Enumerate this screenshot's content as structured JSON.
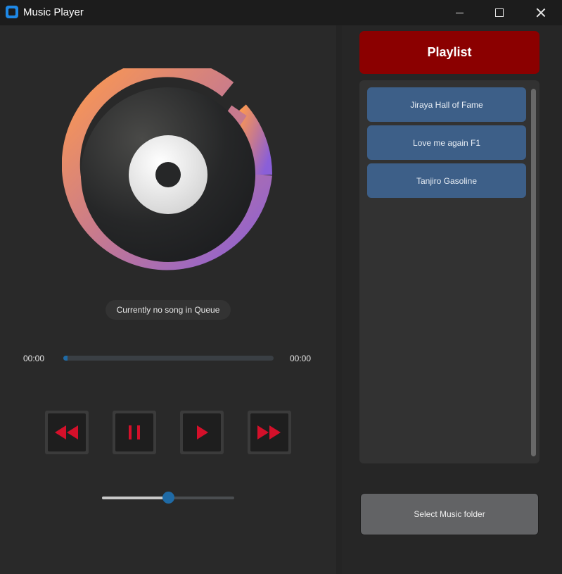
{
  "window": {
    "title": "Music Player",
    "controls": [
      "minimize-icon",
      "maximize-icon",
      "close-icon"
    ]
  },
  "player": {
    "status_text": "Currently no song in Queue",
    "time_elapsed": "00:00",
    "time_total": "00:00",
    "progress": 0.02,
    "volume": 0.5,
    "controls": [
      {
        "name": "rewind-button",
        "icon": "rewind-icon"
      },
      {
        "name": "pause-button",
        "icon": "pause-icon"
      },
      {
        "name": "play-button",
        "icon": "play-icon"
      },
      {
        "name": "forward-button",
        "icon": "fast-forward-icon"
      }
    ]
  },
  "playlist": {
    "header": "Playlist",
    "songs": [
      {
        "label": "Jiraya Hall of Fame"
      },
      {
        "label": "Love me again F1"
      },
      {
        "label": "Tanjiro Gasoline"
      }
    ],
    "select_folder_label": "Select Music folder"
  },
  "colors": {
    "accent_blue": "#1f6aa5",
    "playlist_red": "#8b0000",
    "control_red": "#d4102a",
    "song_item_blue": "#3d5f88"
  }
}
